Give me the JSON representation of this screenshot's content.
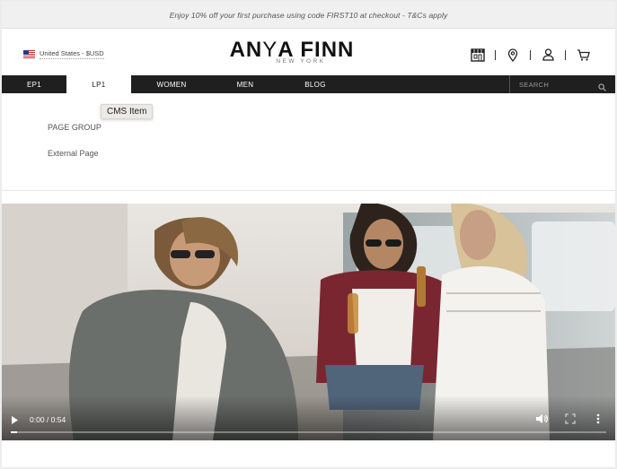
{
  "promo": {
    "text": "Enjoy 10% off your first purchase using code FIRST10 at checkout - T&Cs apply"
  },
  "locale": {
    "label": "United States - $USD",
    "flag_icon": "us-flag-icon"
  },
  "logo": {
    "main_part1": "AN",
    "main_accent": "Y",
    "main_part2": "A FINN",
    "sub": "NEW YORK"
  },
  "header_icons": [
    "store-icon",
    "location-pin-icon",
    "user-icon",
    "cart-icon"
  ],
  "nav": {
    "items": [
      {
        "label": "EP1",
        "active": false
      },
      {
        "label": "LP1",
        "active": true
      },
      {
        "label": "WOMEN",
        "active": false
      },
      {
        "label": "MEN",
        "active": false
      },
      {
        "label": "BLOG",
        "active": false
      }
    ],
    "search_placeholder": "SEARCH"
  },
  "dropdown": {
    "tooltip": "CMS Item",
    "items": [
      "PAGE GROUP",
      "External Page"
    ]
  },
  "video": {
    "time": "0:00 / 0:54",
    "progress": 0.01,
    "icons": [
      "play-icon",
      "volume-icon",
      "fullscreen-icon",
      "more-options-icon"
    ]
  },
  "colors": {
    "nav_bg": "#1f1f1f",
    "promo_bg": "#f0f0f0",
    "active_tab_bg": "#ffffff"
  }
}
